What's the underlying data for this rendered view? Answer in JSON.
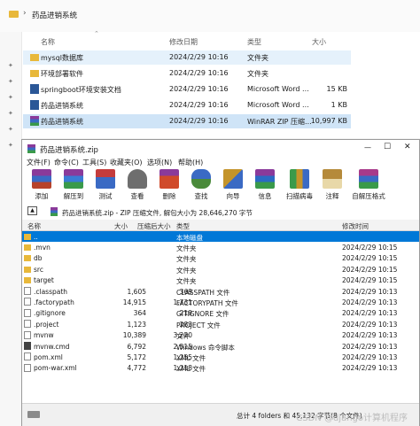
{
  "explorer": {
    "breadcrumb": "药品进销系统",
    "breadcrumb_sep": "›",
    "columns": {
      "name": "名称",
      "modified": "修改日期",
      "type": "类型",
      "size": "大小"
    },
    "rows": [
      {
        "name": "mysql数据库",
        "modified": "2024/2/29 10:16",
        "type": "文件夹",
        "size": "",
        "kind": "folder",
        "state": "hl"
      },
      {
        "name": "环境部署软件",
        "modified": "2024/2/29 10:16",
        "type": "文件夹",
        "size": "",
        "kind": "folder",
        "state": ""
      },
      {
        "name": "springboot环境安装文档",
        "modified": "2024/2/29 10:16",
        "type": "Microsoft Word ...",
        "size": "15 KB",
        "kind": "word",
        "state": ""
      },
      {
        "name": "药品进销系统",
        "modified": "2024/2/29 10:16",
        "type": "Microsoft Word ...",
        "size": "1 KB",
        "kind": "word",
        "state": ""
      },
      {
        "name": "药品进销系统",
        "modified": "2024/2/29 10:16",
        "type": "WinRAR ZIP 压缩...",
        "size": "10,997 KB",
        "kind": "zip",
        "state": "sel"
      }
    ]
  },
  "rar": {
    "title": "药品进销系统.zip",
    "window_buttons": {
      "minimize": "—",
      "maximize": "☐",
      "close": "✕"
    },
    "menu": [
      "文件(F)",
      "命令(C)",
      "工具(S)",
      "收藏夹(O)",
      "选项(N)",
      "帮助(H)"
    ],
    "toolbar": [
      {
        "label": "添加",
        "color": "#b7422a"
      },
      {
        "label": "解压到",
        "color": "#3a7bd5"
      },
      {
        "label": "测试",
        "color": "#c43c3c"
      },
      {
        "label": "查看",
        "color": "#6e6e6e"
      },
      {
        "label": "删除",
        "color": "#d04a2a"
      },
      {
        "label": "查找",
        "color": "#4a8a3a"
      },
      {
        "label": "向导",
        "color": "#c4942a"
      },
      {
        "label": "信息",
        "color": "#2a6ac4"
      },
      {
        "label": "扫描病毒",
        "color": "#3a9a4a"
      },
      {
        "label": "注释",
        "color": "#b58a3a"
      },
      {
        "label": "自解压格式",
        "color": "#a83a8a"
      }
    ],
    "address": "药品进销系统.zip - ZIP 压缩文件, 解包大小为 28,646,270 字节",
    "columns": {
      "name": "名称",
      "size": "大小",
      "packed": "压缩后大小",
      "type": "类型",
      "modified": "修改时间"
    },
    "rows": [
      {
        "name": "..",
        "size": "",
        "packed": "",
        "type": "本地磁盘",
        "modified": "",
        "kind": "up",
        "selected": true
      },
      {
        "name": ".mvn",
        "size": "",
        "packed": "",
        "type": "文件夹",
        "modified": "2024/2/29 10:15",
        "kind": "folder",
        "selected": false
      },
      {
        "name": "db",
        "size": "",
        "packed": "",
        "type": "文件夹",
        "modified": "2024/2/29 10:15",
        "kind": "folder",
        "selected": false
      },
      {
        "name": "src",
        "size": "",
        "packed": "",
        "type": "文件夹",
        "modified": "2024/2/29 10:15",
        "kind": "folder",
        "selected": false
      },
      {
        "name": "target",
        "size": "",
        "packed": "",
        "type": "文件夹",
        "modified": "2024/2/29 10:15",
        "kind": "folder",
        "selected": false
      },
      {
        "name": ".classpath",
        "size": "1,605",
        "packed": "369",
        "type": "CLASSPATH 文件",
        "modified": "2024/2/29 10:13",
        "kind": "file",
        "selected": false
      },
      {
        "name": ".factorypath",
        "size": "14,915",
        "packed": "1,731",
        "type": "FACTORYPATH 文件",
        "modified": "2024/2/29 10:13",
        "kind": "file",
        "selected": false
      },
      {
        "name": ".gitignore",
        "size": "364",
        "packed": "219",
        "type": "GITIGNORE 文件",
        "modified": "2024/2/29 10:13",
        "kind": "file",
        "selected": false
      },
      {
        "name": ".project",
        "size": "1,123",
        "packed": "283",
        "type": "PROJECT 文件",
        "modified": "2024/2/29 10:13",
        "kind": "file",
        "selected": false
      },
      {
        "name": "mvnw",
        "size": "10,389",
        "packed": "3,220",
        "type": "文件",
        "modified": "2024/2/29 10:13",
        "kind": "file",
        "selected": false
      },
      {
        "name": "mvnw.cmd",
        "size": "6,792",
        "packed": "2,515",
        "type": "Windows 命令脚本",
        "modified": "2024/2/29 10:13",
        "kind": "cmd",
        "selected": false
      },
      {
        "name": "pom.xml",
        "size": "5,172",
        "packed": "1,255",
        "type": "XML 文件",
        "modified": "2024/2/29 10:13",
        "kind": "file",
        "selected": false
      },
      {
        "name": "pom-war.xml",
        "size": "4,772",
        "packed": "1,218",
        "type": "XML 文件",
        "modified": "2024/2/29 10:13",
        "kind": "file",
        "selected": false
      }
    ],
    "status": "总计 4 folders 和 45,132 字节(8 个文件)"
  },
  "watermark": "CSDN @django计算机程序"
}
